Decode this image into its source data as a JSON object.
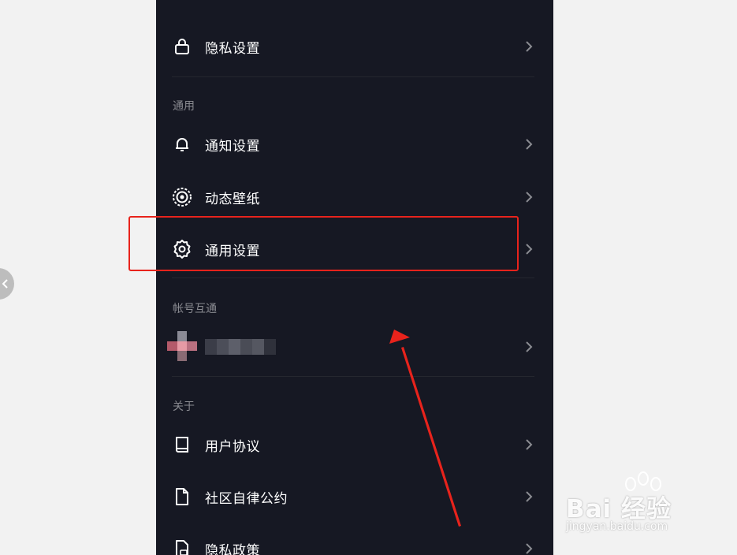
{
  "settings": {
    "rows": {
      "privacy": "隐私设置",
      "notify": "通知设置",
      "wallpaper": "动态壁纸",
      "general": "通用设置",
      "agreement": "用户协议",
      "community": "社区自律公约",
      "policy": "隐私政策"
    },
    "sections": {
      "general": "通用",
      "account_link": "帐号互通",
      "about": "关于"
    }
  },
  "watermark": {
    "brand": "Bai 经验",
    "url": "jingyan.baidu.com"
  },
  "colors": {
    "background": "#161823",
    "highlight": "#e8231c"
  }
}
